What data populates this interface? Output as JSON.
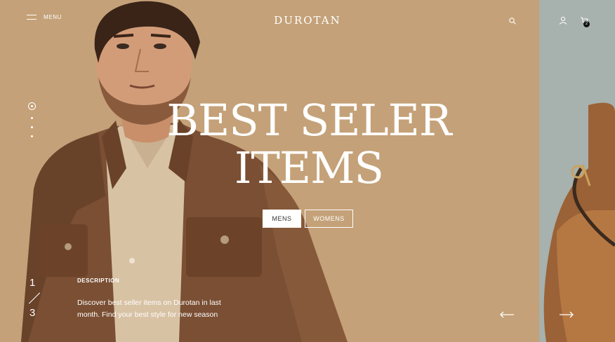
{
  "header": {
    "menu_label": "MENU",
    "brand": "DUROTAN",
    "cart_count": "2"
  },
  "hero": {
    "headline_line1": "BEST SELER",
    "headline_line2": "ITEMS",
    "buttons": {
      "mens": "MENS",
      "womens": "WOMENS"
    },
    "pager": {
      "current": "1",
      "total": "3"
    },
    "description": {
      "title": "DESCRIPTION",
      "text": "Discover best seller items on Durotan in last month. Find your best style for new season"
    }
  },
  "colors": {
    "hero_bg": "#c4a178",
    "side_bg": "#a7b1ad",
    "text": "#ffffff"
  },
  "icons": [
    "menu-icon",
    "search-icon",
    "user-icon",
    "cart-icon",
    "arrow-left-icon",
    "arrow-right-icon"
  ]
}
